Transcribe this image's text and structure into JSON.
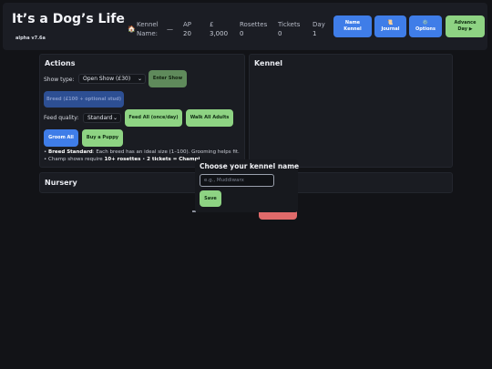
{
  "header": {
    "title": "It’s a Dog’s Life",
    "version": "alpha v7.6a",
    "stats": {
      "kennel": {
        "icon": "house-icon",
        "icon_glyph": "🏠",
        "label_line1": "Kennel",
        "label_line2": "Name:",
        "value": "—"
      },
      "ap": {
        "label": "AP",
        "value": "20"
      },
      "money": {
        "label": "£",
        "value": "3,000"
      },
      "rosettes": {
        "label": "Rosettes",
        "value": "0"
      },
      "tickets": {
        "label": "Tickets",
        "value": "0"
      },
      "day": {
        "label": "Day",
        "value": "1"
      }
    },
    "buttons": {
      "name_kennel": {
        "line1": "Name",
        "line2": "Kennel"
      },
      "journal": {
        "line1": "📜",
        "line2": "Journal"
      },
      "options": {
        "line1": "⚙️",
        "line2": "Options"
      },
      "advance_day": {
        "line1": "Advance",
        "line2": "Day ▶"
      }
    }
  },
  "actions": {
    "title": "Actions",
    "show_type_label": "Show type:",
    "show_type_value": "Open Show (£30)",
    "enter_show": "Enter Show",
    "breed": "Breed (£100 + optional stud)",
    "feed_quality_label": "Feed quality:",
    "feed_quality_value": "Standard",
    "feed_all": "Feed All (once/day)",
    "walk_all": "Walk All Adults",
    "groom_all": "Groom All",
    "buy_puppy": "Buy a Puppy",
    "note1_bold": "Breed Standard",
    "note1_rest": ": Each breed has an ideal size (1–100). Grooming helps fit.",
    "note2_pre": "Champ shows require ",
    "note2_bold": "10+ rosettes",
    "note2_mid": " • ",
    "note2_bold2": "2 tickets = Champi"
  },
  "kennel": {
    "title": "Kennel"
  },
  "nursery": {
    "title": "Nursery"
  },
  "modal": {
    "title": "Choose your kennel name",
    "placeholder": "e.g., Muddiwarx",
    "save": "Save"
  },
  "colors": {
    "accent_blue": "#3f7de8",
    "accent_green": "#8ed383",
    "danger_red": "#e06a6a",
    "background": "#121317"
  }
}
